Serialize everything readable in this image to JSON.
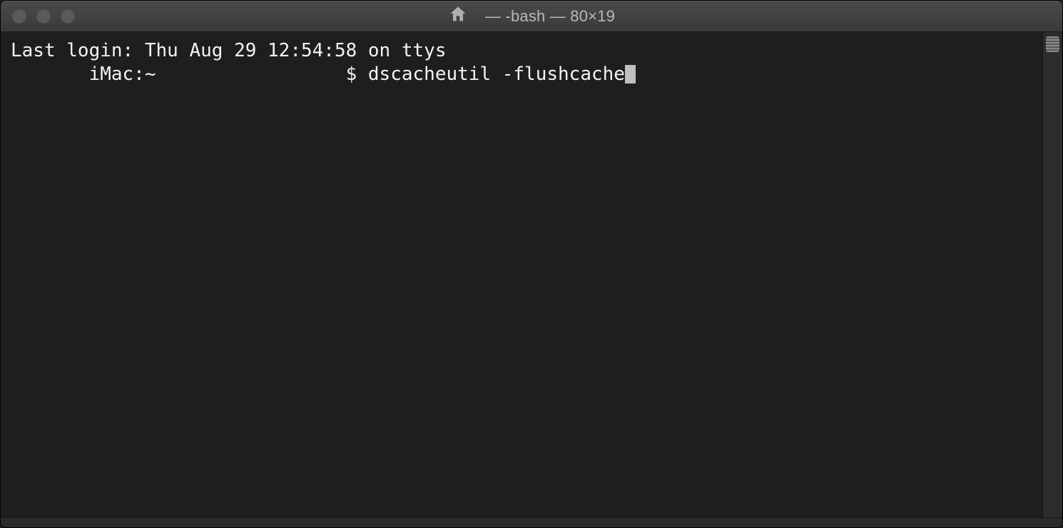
{
  "titlebar": {
    "window_title": "— -bash — 80×19"
  },
  "terminal": {
    "lines": [
      "Last login: Thu Aug 29 12:54:58 on ttys",
      "       iMac:~                 $ dscacheutil -flushcache"
    ]
  },
  "colors": {
    "background": "#1e1e1e",
    "foreground": "#f3f3f3",
    "titlebar_text": "#b8b8b8",
    "traffic_light": "#5a5a5a"
  }
}
